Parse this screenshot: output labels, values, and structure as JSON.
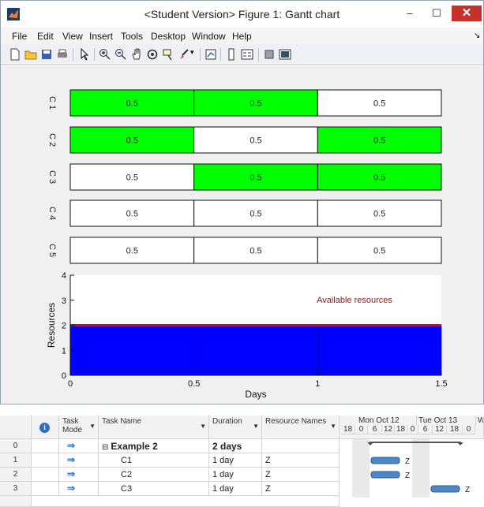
{
  "window": {
    "title": "<Student Version> Figure 1: Gantt chart",
    "minimize_glyph": "–",
    "maximize_glyph": "☐",
    "close_glyph": "✕"
  },
  "menubar": {
    "items": [
      "File",
      "Edit",
      "View",
      "Insert",
      "Tools",
      "Desktop",
      "Window",
      "Help"
    ],
    "overflow_glyph": "↘"
  },
  "toolbar": {
    "icons": [
      "new-figure-icon",
      "open-file-icon",
      "save-icon",
      "print-icon",
      "select-pointer-icon",
      "zoom-in-icon",
      "zoom-out-icon",
      "pan-icon",
      "rotate-3d-icon",
      "data-cursor-icon",
      "brush-icon",
      "link-plot-icon",
      "colorbar-icon",
      "legend-icon",
      "hide-plot-tools-icon",
      "show-plot-tools-icon"
    ]
  },
  "chart_data": [
    {
      "type": "gantt",
      "rows": [
        {
          "label": "C 1",
          "segments": [
            {
              "value": "0.5",
              "color": "#00ff00"
            },
            {
              "value": "0.5",
              "color": "#00ff00"
            },
            {
              "value": "0.5",
              "color": "#ffffff"
            }
          ]
        },
        {
          "label": "C 2",
          "segments": [
            {
              "value": "0.5",
              "color": "#00ff00"
            },
            {
              "value": "0.5",
              "color": "#ffffff"
            },
            {
              "value": "0.5",
              "color": "#00ff00"
            }
          ]
        },
        {
          "label": "C 3",
          "segments": [
            {
              "value": "0.5",
              "color": "#ffffff"
            },
            {
              "value": "0.5",
              "color": "#00ff00"
            },
            {
              "value": "0.5",
              "color": "#00ff00"
            }
          ]
        },
        {
          "label": "C 4",
          "segments": [
            {
              "value": "0.5",
              "color": "#ffffff"
            },
            {
              "value": "0.5",
              "color": "#ffffff"
            },
            {
              "value": "0.5",
              "color": "#ffffff"
            }
          ]
        },
        {
          "label": "C 5",
          "segments": [
            {
              "value": "0.5",
              "color": "#ffffff"
            },
            {
              "value": "0.5",
              "color": "#ffffff"
            },
            {
              "value": "0.5",
              "color": "#ffffff"
            }
          ]
        }
      ]
    },
    {
      "type": "area",
      "x": [
        0,
        0.5,
        1,
        1.5
      ],
      "series": [
        {
          "values": [
            2,
            2,
            2,
            2
          ],
          "color": "#0000ff"
        }
      ],
      "threshold": {
        "value": 2,
        "label": "Available resources",
        "color": "#e8000f"
      },
      "xlabel": "Days",
      "ylabel": "Resources",
      "xlim": [
        0,
        1.5
      ],
      "ylim": [
        0,
        4
      ],
      "xticks": [
        "0",
        "0.5",
        "1",
        "1.5"
      ],
      "yticks": [
        "0",
        "1",
        "2",
        "3",
        "4"
      ]
    }
  ],
  "project": {
    "columns": {
      "info_icon": "i",
      "task_mode": "Task\nMode",
      "task_name": "Task Name",
      "duration": "Duration",
      "resource_names": "Resource Names"
    },
    "rows": [
      {
        "id": "0",
        "name": "Example 2",
        "duration": "2 days",
        "resource": "",
        "summary": true,
        "collapse": "⊟"
      },
      {
        "id": "1",
        "name": "C1",
        "duration": "1 day",
        "resource": "Z",
        "summary": false
      },
      {
        "id": "2",
        "name": "C2",
        "duration": "1 day",
        "resource": "Z",
        "summary": false
      },
      {
        "id": "3",
        "name": "C3",
        "duration": "1 day",
        "resource": "Z",
        "summary": false
      }
    ],
    "timeline": {
      "days": [
        "Mon Oct 12",
        "Tue Oct 13",
        "W"
      ],
      "hours": [
        "18",
        "0",
        "6",
        "12",
        "18",
        "0",
        "6",
        "12",
        "18",
        "0"
      ],
      "bar_labels": [
        "Z",
        "Z",
        "Z"
      ]
    }
  }
}
